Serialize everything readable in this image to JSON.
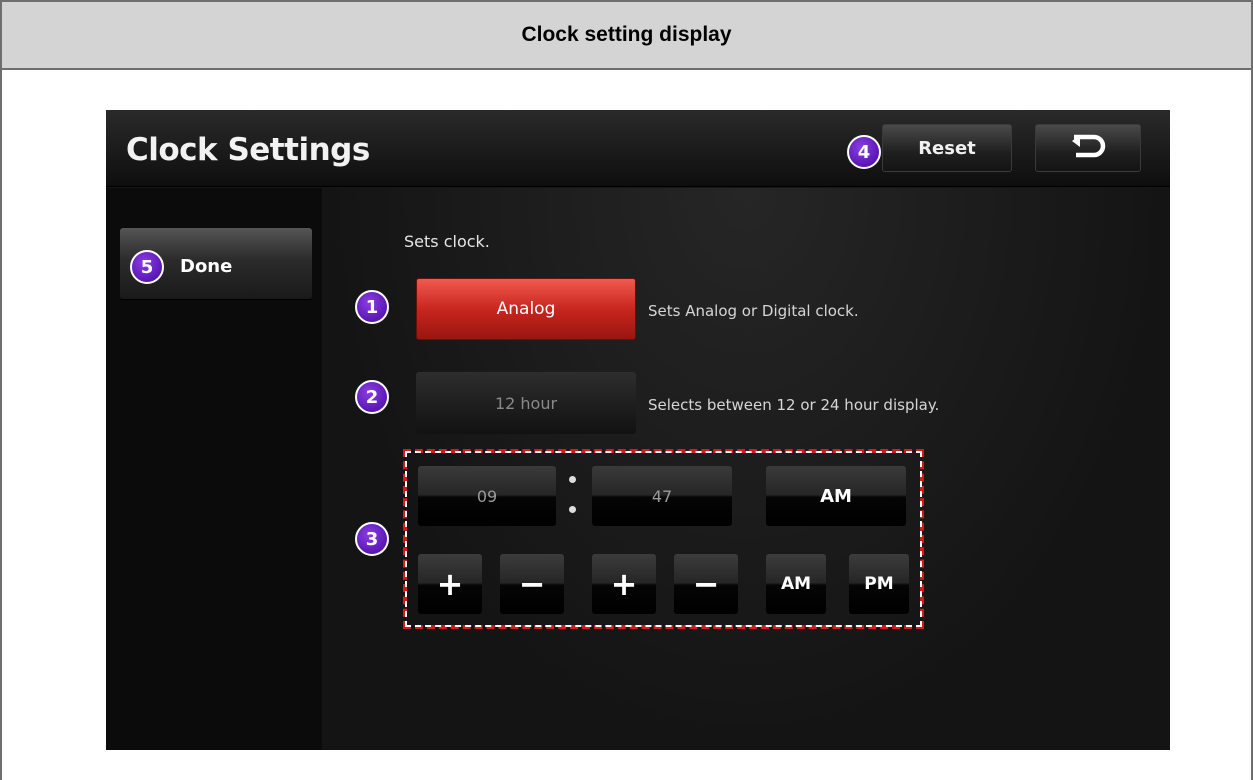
{
  "document": {
    "header": "Clock setting display"
  },
  "screen": {
    "title": "Clock Settings",
    "reset_label": "Reset",
    "done_label": "Done",
    "intro": "Sets clock.",
    "clock_type": {
      "label": "Analog",
      "description": "Sets Analog or Digital clock."
    },
    "hour_mode": {
      "label": "12 hour",
      "description": "Selects between 12 or 24 hour display."
    },
    "time": {
      "hour": "09",
      "minute": "47",
      "period": "AM"
    },
    "adjust": {
      "hour_plus": "+",
      "hour_minus": "−",
      "minute_plus": "+",
      "minute_minus": "−",
      "am": "AM",
      "pm": "PM"
    }
  },
  "callouts": [
    "1",
    "2",
    "3",
    "4",
    "5"
  ],
  "icons": {
    "back": "return-arrow-icon"
  },
  "colors": {
    "accent_red": "#c8261e",
    "callout_purple": "#5b16b6",
    "dashed_border": "#d31b1b"
  }
}
